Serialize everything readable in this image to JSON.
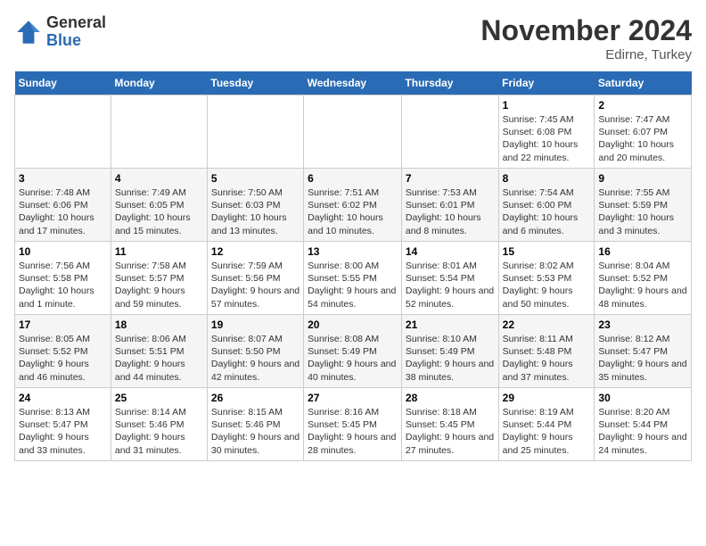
{
  "header": {
    "logo_general": "General",
    "logo_blue": "Blue",
    "month": "November 2024",
    "location": "Edirne, Turkey"
  },
  "weekdays": [
    "Sunday",
    "Monday",
    "Tuesday",
    "Wednesday",
    "Thursday",
    "Friday",
    "Saturday"
  ],
  "weeks": [
    [
      {
        "day": "",
        "info": ""
      },
      {
        "day": "",
        "info": ""
      },
      {
        "day": "",
        "info": ""
      },
      {
        "day": "",
        "info": ""
      },
      {
        "day": "",
        "info": ""
      },
      {
        "day": "1",
        "info": "Sunrise: 7:45 AM\nSunset: 6:08 PM\nDaylight: 10 hours and 22 minutes."
      },
      {
        "day": "2",
        "info": "Sunrise: 7:47 AM\nSunset: 6:07 PM\nDaylight: 10 hours and 20 minutes."
      }
    ],
    [
      {
        "day": "3",
        "info": "Sunrise: 7:48 AM\nSunset: 6:06 PM\nDaylight: 10 hours and 17 minutes."
      },
      {
        "day": "4",
        "info": "Sunrise: 7:49 AM\nSunset: 6:05 PM\nDaylight: 10 hours and 15 minutes."
      },
      {
        "day": "5",
        "info": "Sunrise: 7:50 AM\nSunset: 6:03 PM\nDaylight: 10 hours and 13 minutes."
      },
      {
        "day": "6",
        "info": "Sunrise: 7:51 AM\nSunset: 6:02 PM\nDaylight: 10 hours and 10 minutes."
      },
      {
        "day": "7",
        "info": "Sunrise: 7:53 AM\nSunset: 6:01 PM\nDaylight: 10 hours and 8 minutes."
      },
      {
        "day": "8",
        "info": "Sunrise: 7:54 AM\nSunset: 6:00 PM\nDaylight: 10 hours and 6 minutes."
      },
      {
        "day": "9",
        "info": "Sunrise: 7:55 AM\nSunset: 5:59 PM\nDaylight: 10 hours and 3 minutes."
      }
    ],
    [
      {
        "day": "10",
        "info": "Sunrise: 7:56 AM\nSunset: 5:58 PM\nDaylight: 10 hours and 1 minute."
      },
      {
        "day": "11",
        "info": "Sunrise: 7:58 AM\nSunset: 5:57 PM\nDaylight: 9 hours and 59 minutes."
      },
      {
        "day": "12",
        "info": "Sunrise: 7:59 AM\nSunset: 5:56 PM\nDaylight: 9 hours and 57 minutes."
      },
      {
        "day": "13",
        "info": "Sunrise: 8:00 AM\nSunset: 5:55 PM\nDaylight: 9 hours and 54 minutes."
      },
      {
        "day": "14",
        "info": "Sunrise: 8:01 AM\nSunset: 5:54 PM\nDaylight: 9 hours and 52 minutes."
      },
      {
        "day": "15",
        "info": "Sunrise: 8:02 AM\nSunset: 5:53 PM\nDaylight: 9 hours and 50 minutes."
      },
      {
        "day": "16",
        "info": "Sunrise: 8:04 AM\nSunset: 5:52 PM\nDaylight: 9 hours and 48 minutes."
      }
    ],
    [
      {
        "day": "17",
        "info": "Sunrise: 8:05 AM\nSunset: 5:52 PM\nDaylight: 9 hours and 46 minutes."
      },
      {
        "day": "18",
        "info": "Sunrise: 8:06 AM\nSunset: 5:51 PM\nDaylight: 9 hours and 44 minutes."
      },
      {
        "day": "19",
        "info": "Sunrise: 8:07 AM\nSunset: 5:50 PM\nDaylight: 9 hours and 42 minutes."
      },
      {
        "day": "20",
        "info": "Sunrise: 8:08 AM\nSunset: 5:49 PM\nDaylight: 9 hours and 40 minutes."
      },
      {
        "day": "21",
        "info": "Sunrise: 8:10 AM\nSunset: 5:49 PM\nDaylight: 9 hours and 38 minutes."
      },
      {
        "day": "22",
        "info": "Sunrise: 8:11 AM\nSunset: 5:48 PM\nDaylight: 9 hours and 37 minutes."
      },
      {
        "day": "23",
        "info": "Sunrise: 8:12 AM\nSunset: 5:47 PM\nDaylight: 9 hours and 35 minutes."
      }
    ],
    [
      {
        "day": "24",
        "info": "Sunrise: 8:13 AM\nSunset: 5:47 PM\nDaylight: 9 hours and 33 minutes."
      },
      {
        "day": "25",
        "info": "Sunrise: 8:14 AM\nSunset: 5:46 PM\nDaylight: 9 hours and 31 minutes."
      },
      {
        "day": "26",
        "info": "Sunrise: 8:15 AM\nSunset: 5:46 PM\nDaylight: 9 hours and 30 minutes."
      },
      {
        "day": "27",
        "info": "Sunrise: 8:16 AM\nSunset: 5:45 PM\nDaylight: 9 hours and 28 minutes."
      },
      {
        "day": "28",
        "info": "Sunrise: 8:18 AM\nSunset: 5:45 PM\nDaylight: 9 hours and 27 minutes."
      },
      {
        "day": "29",
        "info": "Sunrise: 8:19 AM\nSunset: 5:44 PM\nDaylight: 9 hours and 25 minutes."
      },
      {
        "day": "30",
        "info": "Sunrise: 8:20 AM\nSunset: 5:44 PM\nDaylight: 9 hours and 24 minutes."
      }
    ]
  ]
}
